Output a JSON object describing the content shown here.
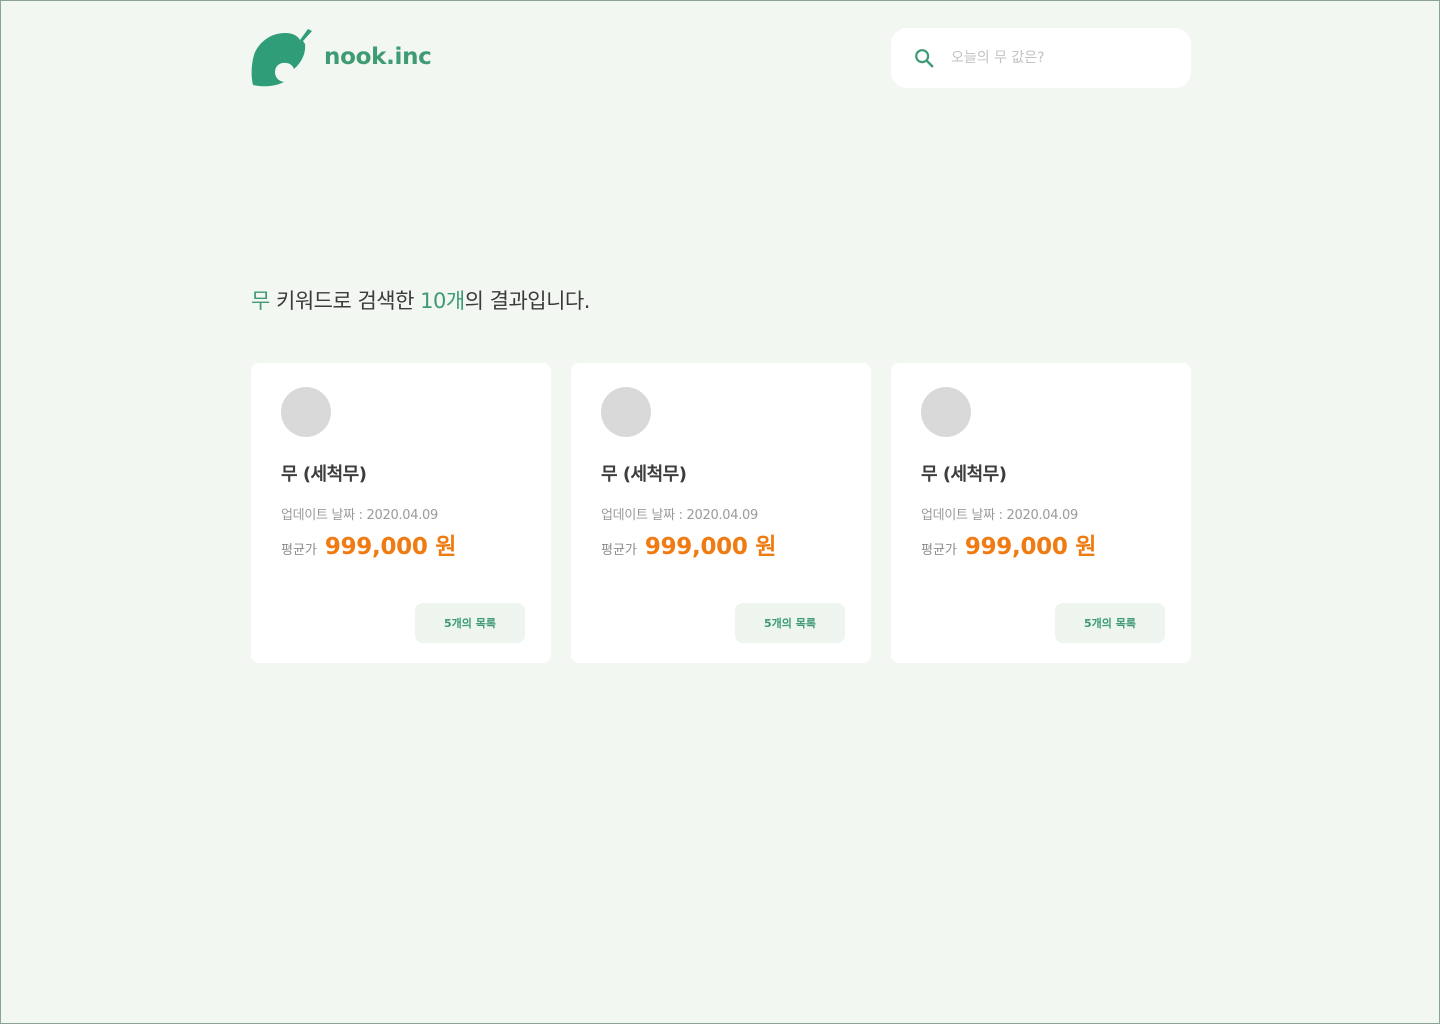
{
  "brand": {
    "name": "nook.inc",
    "color": "#3e9b73"
  },
  "search": {
    "placeholder": "오늘의 무 값은?",
    "value": ""
  },
  "result": {
    "keyword": "무",
    "text_middle": " 키워드로 검색한 ",
    "count": "10개",
    "text_end": "의 결과입니다."
  },
  "cards": [
    {
      "name": "무 (세척무)",
      "updated": "업데이트 날짜 : 2020.04.09",
      "price_label": "평균가",
      "price": "999,000 원",
      "button": "5개의 목록"
    },
    {
      "name": "무 (세척무)",
      "updated": "업데이트 날짜 : 2020.04.09",
      "price_label": "평균가",
      "price": "999,000 원",
      "button": "5개의 목록"
    },
    {
      "name": "무 (세척무)",
      "updated": "업데이트 날짜 : 2020.04.09",
      "price_label": "평균가",
      "price": "999,000 원",
      "button": "5개의 목록"
    }
  ],
  "colors": {
    "accent": "#3e9b73",
    "price": "#f07b12",
    "background": "#f2f7f1"
  }
}
